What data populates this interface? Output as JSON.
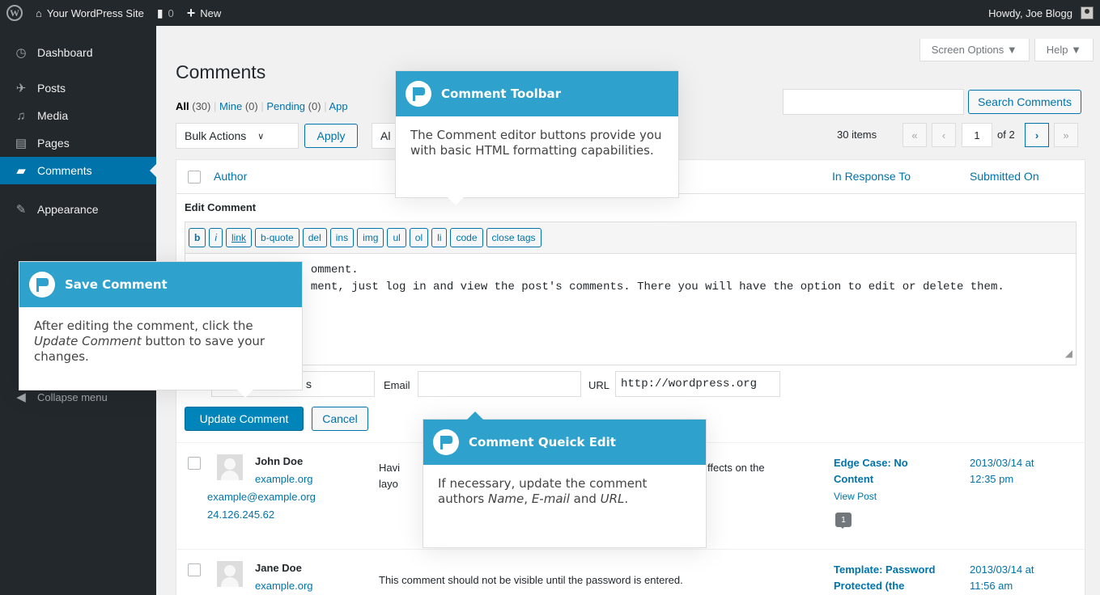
{
  "adminbar": {
    "site_name": "Your WordPress Site",
    "comments_count": "0",
    "new_label": "New",
    "howdy": "Howdy, Joe Blogg"
  },
  "sidebar": {
    "items": [
      {
        "label": "Dashboard",
        "icon": "dashboard-icon"
      },
      {
        "label": "Posts",
        "icon": "pin-icon"
      },
      {
        "label": "Media",
        "icon": "media-icon"
      },
      {
        "label": "Pages",
        "icon": "pages-icon"
      },
      {
        "label": "Comments",
        "icon": "comment-icon"
      },
      {
        "label": "Appearance",
        "icon": "brush-icon"
      }
    ],
    "collapse": "Collapse menu"
  },
  "screen_options": "Screen Options ▼",
  "help": "Help ▼",
  "page_title": "Comments",
  "filters": {
    "all": "All",
    "all_count": "(30)",
    "mine": "Mine",
    "mine_count": "(0)",
    "pending": "Pending",
    "pending_count": "(0)",
    "approved_partial": "App"
  },
  "search_button": "Search Comments",
  "bulk_actions": "Bulk Actions",
  "apply": "Apply",
  "filter_partial": "Al",
  "pagination": {
    "items": "30 items",
    "first": "«",
    "prev": "‹",
    "current_page": "1",
    "of": "of 2",
    "next": "›",
    "last": "»"
  },
  "table": {
    "col_author": "Author",
    "col_response": "In Response To",
    "col_submitted": "Submitted On"
  },
  "edit": {
    "title": "Edit Comment",
    "quicktags": [
      "b",
      "i",
      "link",
      "b-quote",
      "del",
      "ins",
      "img",
      "ul",
      "ol",
      "li",
      "code",
      "close tags"
    ],
    "text_line1": "                 omment.",
    "text_line2": "                 ment, just log in and view the post's comments. There you will have the option to edit or delete them.",
    "name_value": "s",
    "email_label": "Email",
    "email_value": "",
    "url_label": "URL",
    "url_value": "http://wordpress.org",
    "update": "Update Comment",
    "cancel": "Cancel"
  },
  "rows": [
    {
      "name": "John Doe",
      "site": "example.org",
      "email": "example@example.org",
      "ip": "24.126.245.62",
      "comment_start": "Havi",
      "comment_line2": "layo",
      "comment_end": "ffects on the",
      "response_title": "Edge Case: No Content",
      "view_post": "View Post",
      "bubble": "1",
      "date": "2013/03/14 at",
      "time": "12:35 pm"
    },
    {
      "name": "Jane Doe",
      "site": "example.org",
      "comment": "This comment should not be visible until the password is entered.",
      "response_title": "Template: Password Protected (the",
      "date": "2013/03/14 at",
      "time": "11:56 am"
    }
  ],
  "pointers": {
    "toolbar": {
      "title": "Comment Toolbar",
      "body": "The Comment editor buttons provide you with basic HTML formatting capabilities."
    },
    "save": {
      "title": "Save Comment",
      "body_pre": "After editing the comment, click the ",
      "body_em": "Update Comment",
      "body_post": " button to save your changes."
    },
    "quick": {
      "title": "Comment Queick Edit",
      "body_pre": "If necessary, update the comment authors ",
      "name_em": "Name",
      "sep": ", ",
      "email_em": "E-mail",
      "and": " and ",
      "url_em": "URL",
      "end": "."
    }
  }
}
